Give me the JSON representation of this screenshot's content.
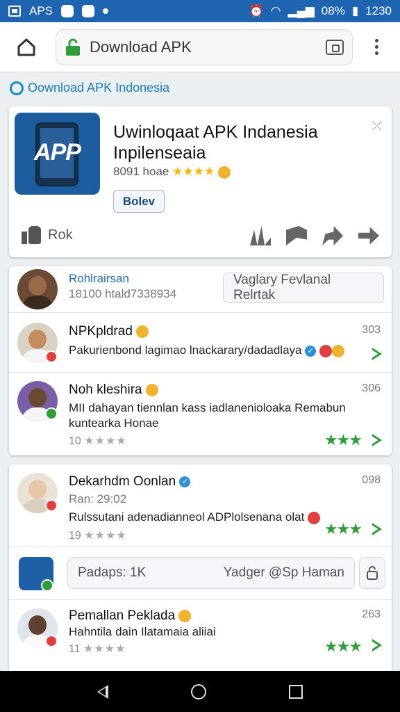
{
  "status_bar": {
    "left_text": "APS",
    "battery": "08%",
    "time": "1230"
  },
  "browser": {
    "url_text": "Download APK"
  },
  "breadcrumb": {
    "label": "Oownload APK  Indonesia"
  },
  "app_card": {
    "icon_label": "APP",
    "title": "Uwinloqaat APK Indanesia Inpilenseaia",
    "meta_count": "8091 hoae",
    "meta_stars": "★★★★",
    "button_label": "Bolev",
    "like_label": "Rok",
    "corner": "⤫"
  },
  "list_card_1": {
    "header": {
      "name": "Rohlrairsan",
      "sub": "18100 htald7338934",
      "input": "Vaglary Fevlanal Relrtak"
    },
    "rows": [
      {
        "name": "NPKpldrad",
        "text": "Pakurienbond lagimao lnackarary/dadadlaya",
        "count": "303",
        "stars": "",
        "rating": ""
      },
      {
        "name": "Noh kleshira",
        "text": "MII dahayan tiennlan kass iadlanenioloaka Remabun kuntearka Honae",
        "count": "306",
        "stars": "★★★",
        "rating": "10"
      }
    ]
  },
  "list_card_2": {
    "rows": [
      {
        "name": "Dekarhdm Oonlan",
        "sub": "Ran: 29:02",
        "text": "Rulssutani adenadianneol ADPlolsenana olat",
        "count": "098",
        "stars": "★★★",
        "rating": "19"
      },
      {
        "name": "Pemallan Peklada",
        "text": "Hahntila dain Ilatamaia aliiai",
        "count": "263",
        "stars": "★★★",
        "rating": "11"
      }
    ],
    "input": {
      "left": "Padaps: 1K",
      "right": "Yadger @Sp Haman"
    }
  },
  "rating_stars": "★★★★"
}
